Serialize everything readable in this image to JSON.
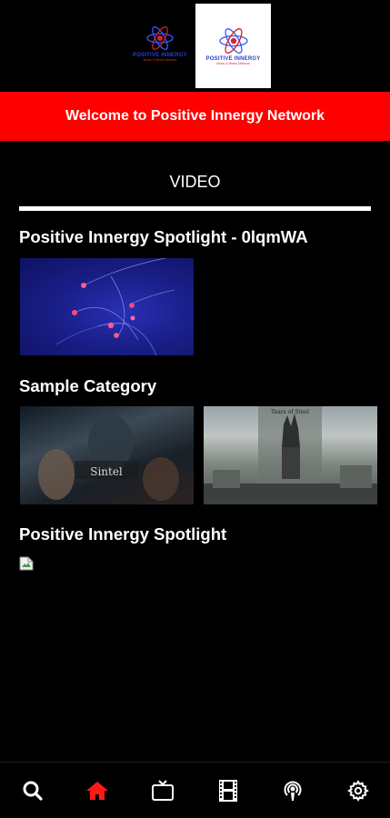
{
  "header": {
    "logo_small": {
      "title": "POSITIVE INNERGY",
      "subtitle": "Music & Media Network"
    },
    "logo_big": {
      "title": "POSITIVE INNERGY",
      "subtitle": "Music & Media Network"
    }
  },
  "banner": {
    "text": "Welcome to Positive Innergy Network"
  },
  "tab": {
    "label": "VIDEO"
  },
  "sections": [
    {
      "title": "Positive Innergy Spotlight - 0lqmWA"
    },
    {
      "title": "Sample Category",
      "thumbs": [
        {
          "caption": "Sintel"
        },
        {
          "caption": "Tears of Steel"
        }
      ]
    },
    {
      "title": "Positive Innergy Spotlight"
    }
  ],
  "nav": {
    "items": [
      {
        "name": "search",
        "icon": "search-icon"
      },
      {
        "name": "home",
        "icon": "home-icon",
        "active": true
      },
      {
        "name": "tv",
        "icon": "tv-icon"
      },
      {
        "name": "video",
        "icon": "film-icon"
      },
      {
        "name": "podcast",
        "icon": "podcast-icon"
      },
      {
        "name": "settings",
        "icon": "gear-icon"
      }
    ]
  },
  "colors": {
    "background": "#000000",
    "banner": "#ff0000",
    "accent": "#ff1a1a",
    "text": "#ffffff"
  }
}
